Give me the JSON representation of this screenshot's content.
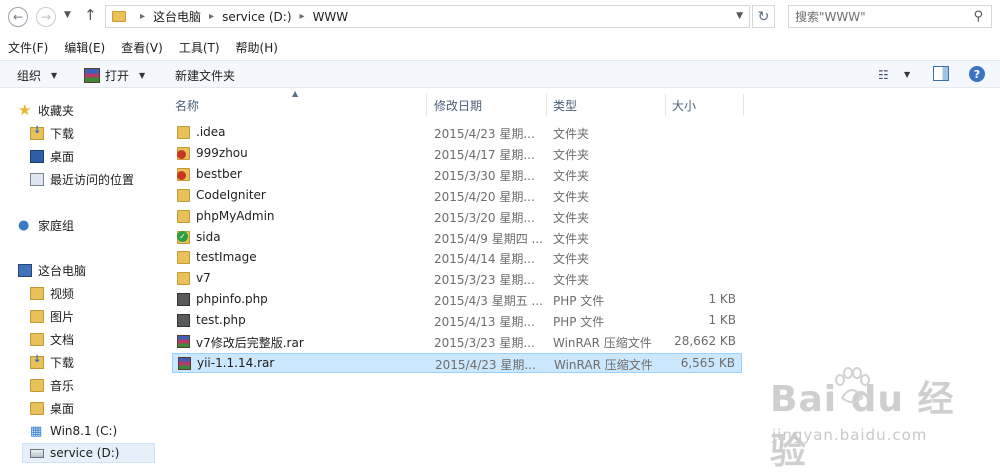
{
  "address": {
    "crumbs": [
      "这台电脑",
      "service (D:)",
      "WWW"
    ],
    "search_placeholder": "搜索\"WWW\""
  },
  "menu": [
    "文件(F)",
    "编辑(E)",
    "查看(V)",
    "工具(T)",
    "帮助(H)"
  ],
  "toolbar": {
    "organize": "组织",
    "open": "打开",
    "new_folder": "新建文件夹"
  },
  "nav": {
    "favorites": "收藏夹",
    "downloads": "下载",
    "desktop": "桌面",
    "recent": "最近访问的位置",
    "homegroup": "家庭组",
    "this_pc": "这台电脑",
    "videos": "视频",
    "pictures": "图片",
    "documents": "文档",
    "downloads2": "下载",
    "music": "音乐",
    "desktop2": "桌面",
    "drive_c": "Win8.1 (C:)",
    "drive_d": "service (D:)"
  },
  "columns": {
    "name": "名称",
    "date": "修改日期",
    "type": "类型",
    "size": "大小"
  },
  "files": [
    {
      "name": ".idea",
      "date": "2015/4/23 星期...",
      "type": "文件夹",
      "size": "",
      "icon": "folder"
    },
    {
      "name": "999zhou",
      "date": "2015/4/17 星期...",
      "type": "文件夹",
      "size": "",
      "icon": "folder-conflict"
    },
    {
      "name": "bestber",
      "date": "2015/3/30 星期...",
      "type": "文件夹",
      "size": "",
      "icon": "folder-conflict"
    },
    {
      "name": "CodeIgniter",
      "date": "2015/4/20 星期...",
      "type": "文件夹",
      "size": "",
      "icon": "folder"
    },
    {
      "name": "phpMyAdmin",
      "date": "2015/3/20 星期...",
      "type": "文件夹",
      "size": "",
      "icon": "folder"
    },
    {
      "name": "sida",
      "date": "2015/4/9 星期四 ...",
      "type": "文件夹",
      "size": "",
      "icon": "folder-synced"
    },
    {
      "name": "testImage",
      "date": "2015/4/14 星期...",
      "type": "文件夹",
      "size": "",
      "icon": "folder"
    },
    {
      "name": "v7",
      "date": "2015/3/23 星期...",
      "type": "文件夹",
      "size": "",
      "icon": "folder"
    },
    {
      "name": "phpinfo.php",
      "date": "2015/4/3 星期五 ...",
      "type": "PHP 文件",
      "size": "1 KB",
      "icon": "php"
    },
    {
      "name": "test.php",
      "date": "2015/4/13 星期...",
      "type": "PHP 文件",
      "size": "1 KB",
      "icon": "php"
    },
    {
      "name": "v7修改后完整版.rar",
      "date": "2015/3/23 星期...",
      "type": "WinRAR 压缩文件",
      "size": "28,662 KB",
      "icon": "rar"
    },
    {
      "name": "yii-1.1.14.rar",
      "date": "2015/4/23 星期...",
      "type": "WinRAR 压缩文件",
      "size": "6,565 KB",
      "icon": "rar",
      "selected": true
    }
  ],
  "watermark": {
    "logo": "Bai du 经验",
    "url": "jingyan.baidu.com"
  }
}
